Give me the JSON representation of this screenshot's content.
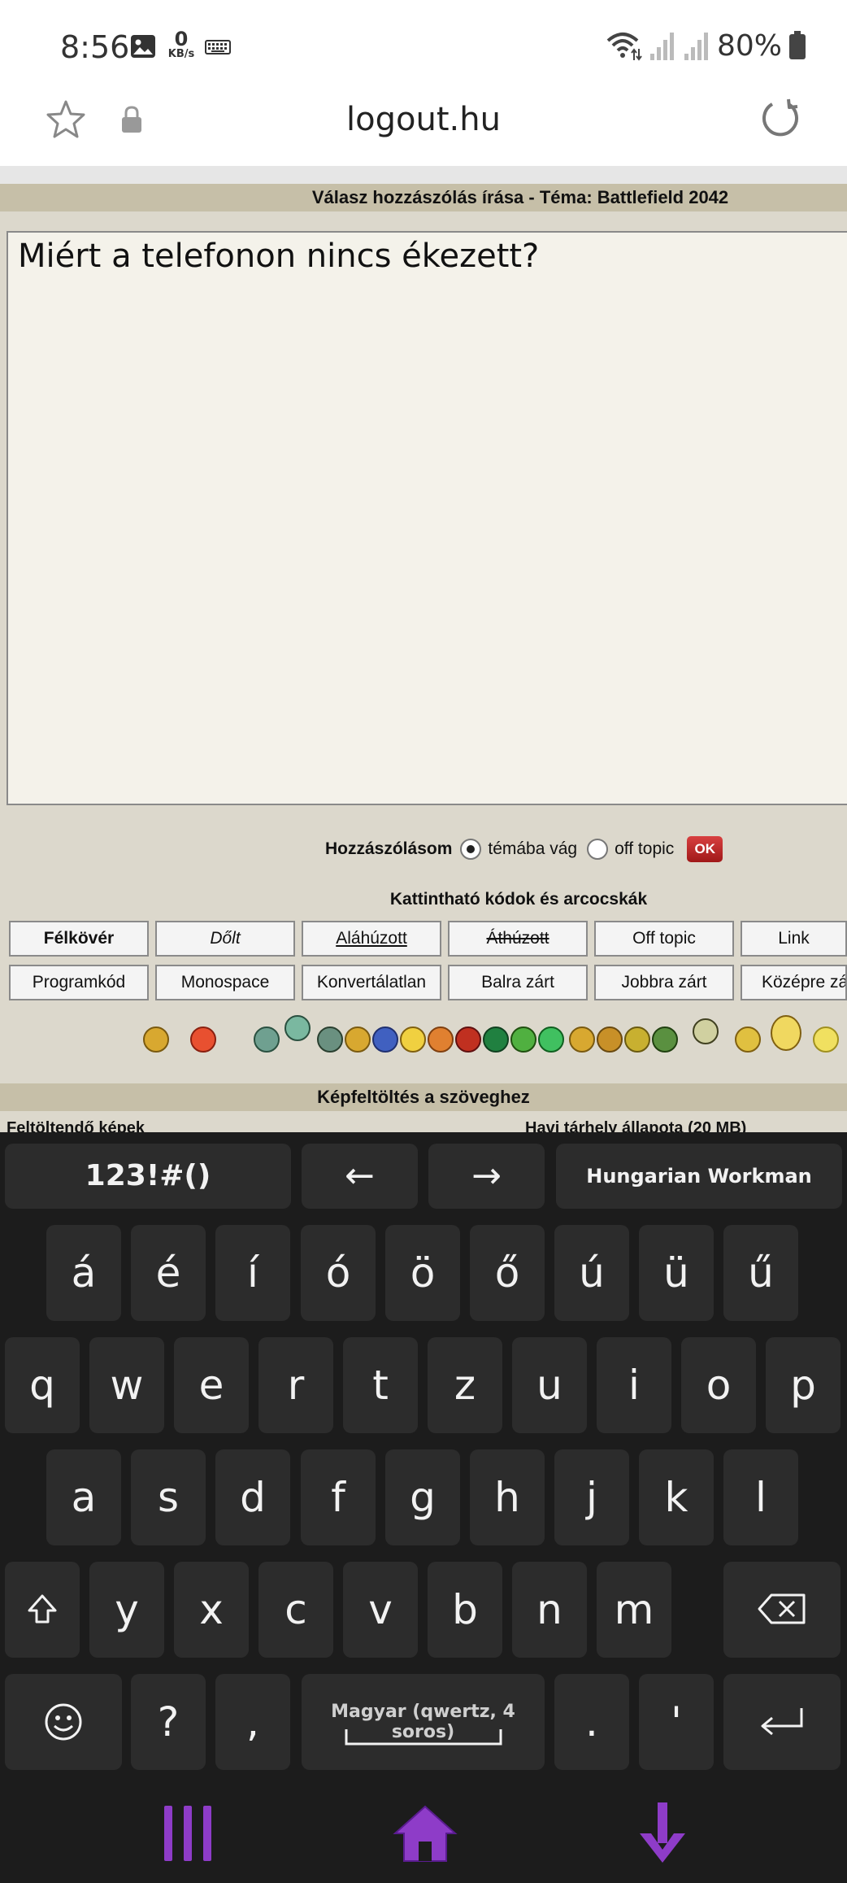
{
  "status_bar": {
    "time": "8:56",
    "speed_value": "0",
    "speed_unit": "KB/s",
    "battery": "80%"
  },
  "url_bar": {
    "url": "logout.hu"
  },
  "page": {
    "reply_title": "Válasz hozzászólás írása - Téma: Battlefield 2042",
    "comment_text": "Miért a telefonon nincs ékezett?",
    "post_label": "Hozzászólásom",
    "radio_options": [
      "témába vág",
      "off topic"
    ],
    "ok_label": "OK",
    "codes_title": "Kattintható kódok és arcocskák",
    "format_row1": [
      "Félkövér",
      "Dőlt",
      "Aláhúzott",
      "Áthúzott",
      "Off topic",
      "Link"
    ],
    "format_row2": [
      "Programkód",
      "Monospace",
      "Konvertálatlan",
      "Balra zárt",
      "Jobbra zárt",
      "Középre zá"
    ],
    "image_upload_title": "Képfeltöltés a szöveghez",
    "cut_left": "Feltöltendő képek",
    "cut_right": "Havi tárhely állapota (20 MB)"
  },
  "keyboard": {
    "symbols_key": "123!#()",
    "left_arrow": "←",
    "right_arrow": "→",
    "layout_name": "Hungarian Workman",
    "row_accents": [
      "á",
      "é",
      "í",
      "ó",
      "ö",
      "ő",
      "ú",
      "ü",
      "ű"
    ],
    "row1": [
      "q",
      "w",
      "e",
      "r",
      "t",
      "z",
      "u",
      "i",
      "o",
      "p"
    ],
    "row2": [
      "a",
      "s",
      "d",
      "f",
      "g",
      "h",
      "j",
      "k",
      "l"
    ],
    "row3": [
      "y",
      "x",
      "c",
      "v",
      "b",
      "n",
      "m"
    ],
    "question": "?",
    "comma": ",",
    "space_label": "Magyar (qwertz, 4 soros)",
    "period": ".",
    "apostrophe": "'"
  },
  "colors": {
    "page_bg": "#dcd8cc",
    "header_bar": "#c6bfa8",
    "keyboard_bg": "#1c1c1c",
    "key_bg": "#2c2c2c",
    "nav_accent": "#8e3cc8",
    "ok_button": "#c02828"
  }
}
